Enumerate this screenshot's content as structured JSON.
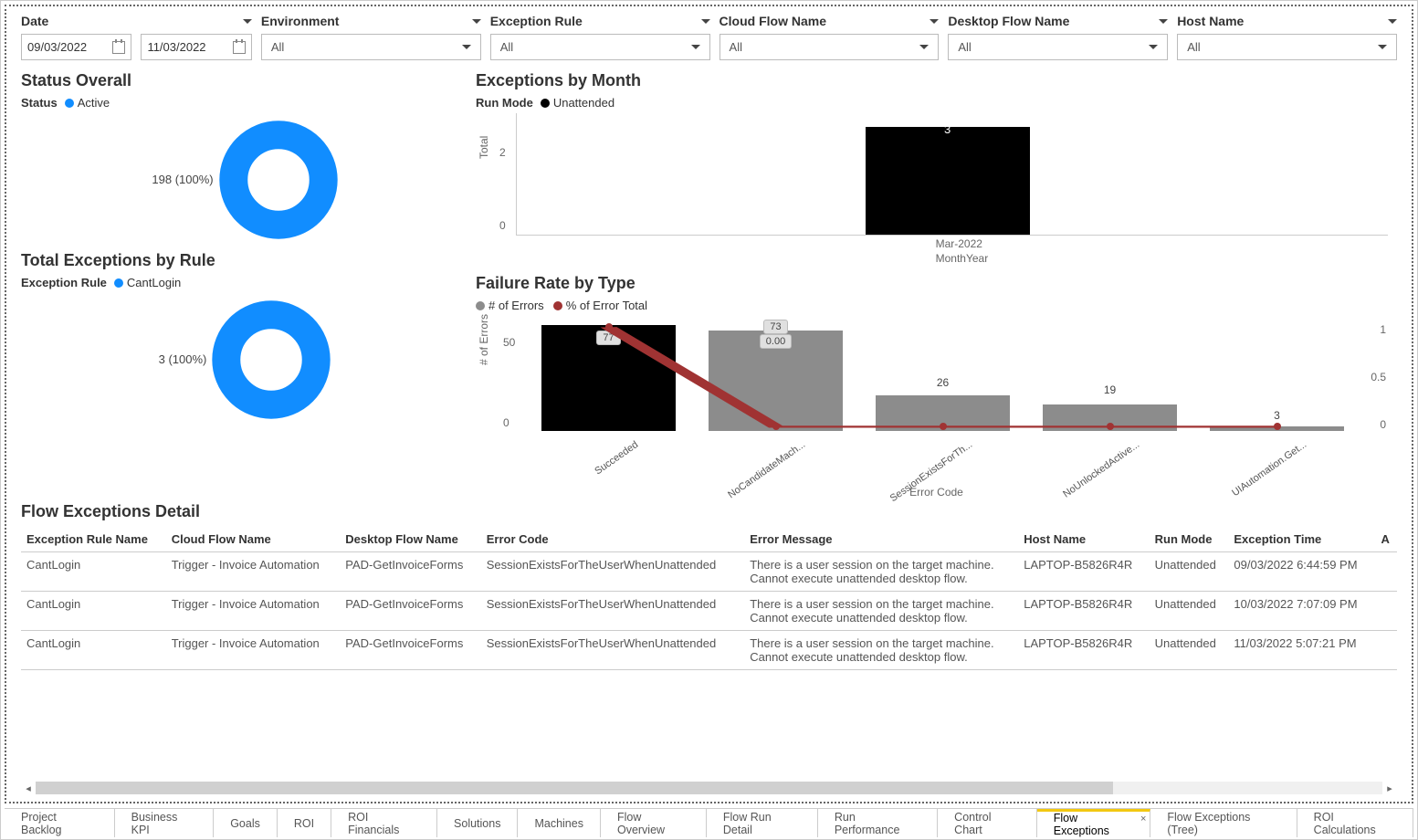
{
  "filters": {
    "date": {
      "label": "Date",
      "start": "09/03/2022",
      "end": "11/03/2022"
    },
    "environment": {
      "label": "Environment",
      "value": "All"
    },
    "exception_rule": {
      "label": "Exception Rule",
      "value": "All"
    },
    "cloud_flow": {
      "label": "Cloud Flow Name",
      "value": "All"
    },
    "desktop_flow": {
      "label": "Desktop Flow Name",
      "value": "All"
    },
    "host": {
      "label": "Host Name",
      "value": "All"
    }
  },
  "status_overall": {
    "title": "Status Overall",
    "legend_label": "Status",
    "legend_value": "Active",
    "data_label": "198 (100%)"
  },
  "exceptions_by_month": {
    "title": "Exceptions by Month",
    "legend_label": "Run Mode",
    "legend_value": "Unattended",
    "x_axis": "MonthYear",
    "y_axis": "Total"
  },
  "total_by_rule": {
    "title": "Total Exceptions by Rule",
    "legend_label": "Exception Rule",
    "legend_value": "CantLogin",
    "data_label": "3 (100%)"
  },
  "failure_rate": {
    "title": "Failure Rate by Type",
    "legend1": "# of Errors",
    "legend2": "% of Error Total",
    "y_axis": "# of Errors",
    "x_axis": "Error Code",
    "box1": "77",
    "box2": "73",
    "box3": "0.00"
  },
  "detail": {
    "title": "Flow Exceptions Detail",
    "headers": {
      "c0": "Exception Rule Name",
      "c1": "Cloud Flow Name",
      "c2": "Desktop Flow Name",
      "c3": "Error Code",
      "c4": "Error Message",
      "c5": "Host Name",
      "c6": "Run Mode",
      "c7": "Exception Time",
      "c8": "A"
    },
    "rows": [
      {
        "c0": "CantLogin",
        "c1": "Trigger - Invoice Automation",
        "c2": "PAD-GetInvoiceForms",
        "c3": "SessionExistsForTheUserWhenUnattended",
        "c4": "There is a user session on the target machine. Cannot execute unattended desktop flow.",
        "c5": "LAPTOP-B5826R4R",
        "c6": "Unattended",
        "c7": "09/03/2022 6:44:59 PM"
      },
      {
        "c0": "CantLogin",
        "c1": "Trigger - Invoice Automation",
        "c2": "PAD-GetInvoiceForms",
        "c3": "SessionExistsForTheUserWhenUnattended",
        "c4": "There is a user session on the target machine. Cannot execute unattended desktop flow.",
        "c5": "LAPTOP-B5826R4R",
        "c6": "Unattended",
        "c7": "10/03/2022 7:07:09 PM"
      },
      {
        "c0": "CantLogin",
        "c1": "Trigger - Invoice Automation",
        "c2": "PAD-GetInvoiceForms",
        "c3": "SessionExistsForTheUserWhenUnattended",
        "c4": "There is a user session on the target machine. Cannot execute unattended desktop flow.",
        "c5": "LAPTOP-B5826R4R",
        "c6": "Unattended",
        "c7": "11/03/2022 5:07:21 PM"
      }
    ]
  },
  "tabs": [
    "Project Backlog",
    "Business KPI",
    "Goals",
    "ROI",
    "ROI Financials",
    "Solutions",
    "Machines",
    "Flow Overview",
    "Flow Run Detail",
    "Run Performance",
    "Control Chart",
    "Flow Exceptions",
    "Flow Exceptions (Tree)",
    "ROI Calculations"
  ],
  "active_tab": "Flow Exceptions",
  "chart_data": [
    {
      "type": "pie",
      "title": "Status Overall",
      "series": [
        {
          "name": "Active",
          "value": 198,
          "pct": 100,
          "color": "#118DFF"
        }
      ]
    },
    {
      "type": "bar",
      "title": "Exceptions by Month",
      "xlabel": "MonthYear",
      "ylabel": "Total",
      "categories": [
        "Mar-2022"
      ],
      "series": [
        {
          "name": "Unattended",
          "values": [
            3
          ],
          "color": "#000000"
        }
      ],
      "ylim": [
        0,
        3
      ],
      "yticks": [
        0,
        2
      ]
    },
    {
      "type": "pie",
      "title": "Total Exceptions by Rule",
      "series": [
        {
          "name": "CantLogin",
          "value": 3,
          "pct": 100,
          "color": "#118DFF"
        }
      ]
    },
    {
      "type": "bar",
      "title": "Failure Rate by Type",
      "xlabel": "Error Code",
      "ylabel": "# of Errors",
      "y2label": "% of Error Total",
      "categories": [
        "Succeeded",
        "NoCandidateMach...",
        "SessionExistsForTh...",
        "NoUnlockedActive...",
        "UIAutomation.Get..."
      ],
      "series": [
        {
          "name": "# of Errors",
          "values": [
            77,
            73,
            26,
            19,
            3
          ],
          "colors": [
            "#000000",
            "#8c8c8c",
            "#8c8c8c",
            "#8c8c8c",
            "#8c8c8c"
          ]
        },
        {
          "name": "% of Error Total",
          "type": "line",
          "values": [
            null,
            0.0,
            null,
            null,
            null
          ],
          "color": "#a03333"
        }
      ],
      "ylim": [
        0,
        77
      ],
      "yticks": [
        0,
        50
      ],
      "y2lim": [
        0.0,
        1.0
      ],
      "y2ticks": [
        0.0,
        0.5,
        1.0
      ]
    }
  ]
}
